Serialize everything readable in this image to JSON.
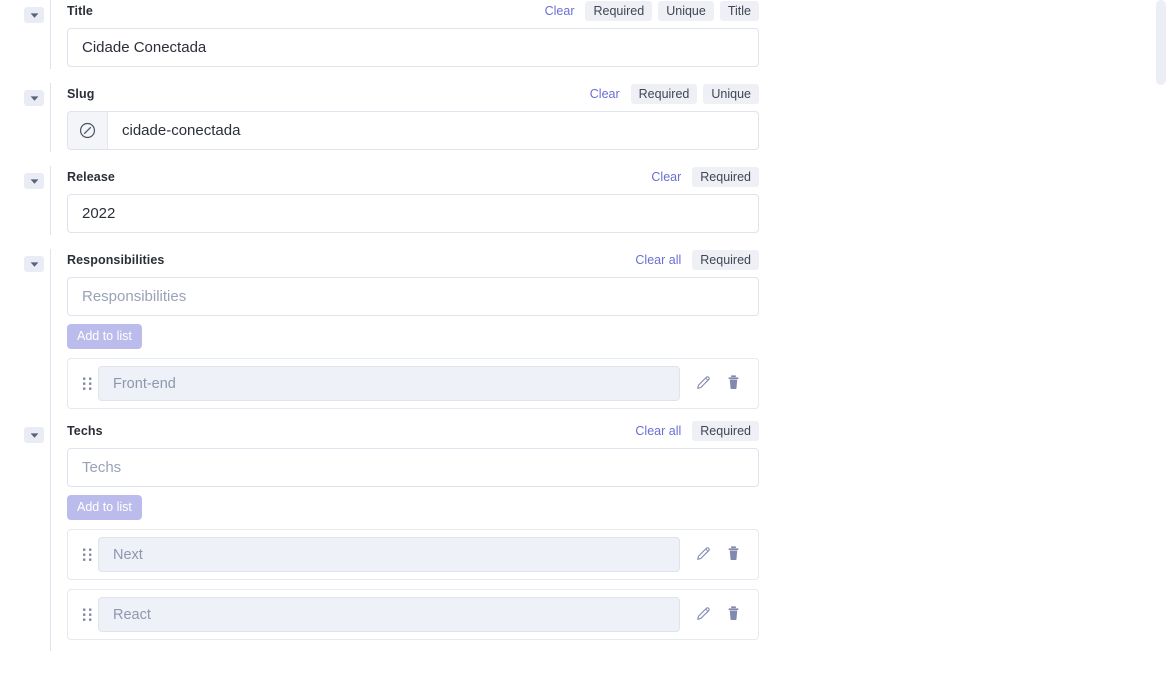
{
  "fields": [
    {
      "key": "title",
      "label": "Title",
      "clear_label": "Clear",
      "badges": [
        "Required",
        "Unique",
        "Title"
      ],
      "value": "Cidade Conectada",
      "placeholder": "",
      "prefix_icon": null,
      "type": "text"
    },
    {
      "key": "slug",
      "label": "Slug",
      "clear_label": "Clear",
      "badges": [
        "Required",
        "Unique"
      ],
      "value": "cidade-conectada",
      "placeholder": "",
      "prefix_icon": "link-icon",
      "type": "text"
    },
    {
      "key": "release",
      "label": "Release",
      "clear_label": "Clear",
      "badges": [
        "Required"
      ],
      "value": "2022",
      "placeholder": "",
      "prefix_icon": null,
      "type": "text"
    },
    {
      "key": "responsibilities",
      "label": "Responsibilities",
      "clear_label": "Clear all",
      "badges": [
        "Required"
      ],
      "value": "",
      "placeholder": "Responsibilities",
      "prefix_icon": null,
      "type": "list",
      "add_label": "Add to list",
      "items": [
        "Front-end"
      ]
    },
    {
      "key": "techs",
      "label": "Techs",
      "clear_label": "Clear all",
      "badges": [
        "Required"
      ],
      "value": "",
      "placeholder": "Techs",
      "prefix_icon": null,
      "type": "list",
      "add_label": "Add to list",
      "items": [
        "Next",
        "React"
      ]
    }
  ],
  "icons": {
    "collapse": "chevron-down-icon",
    "drag": "drag-handle-icon",
    "edit": "pencil-icon",
    "delete": "trash-icon",
    "link": "link-icon"
  },
  "colors": {
    "link": "#6a6fd4",
    "badge_bg": "#eef0f5",
    "add_button_bg": "#bcbcec",
    "row_input_bg": "#eef1f7",
    "icon": "#8289ae",
    "scrollbar_thumb": "#eceef5",
    "border": "#dfe3ec"
  },
  "scrollbar": {
    "thumb_top": 0,
    "thumb_height": 85
  }
}
